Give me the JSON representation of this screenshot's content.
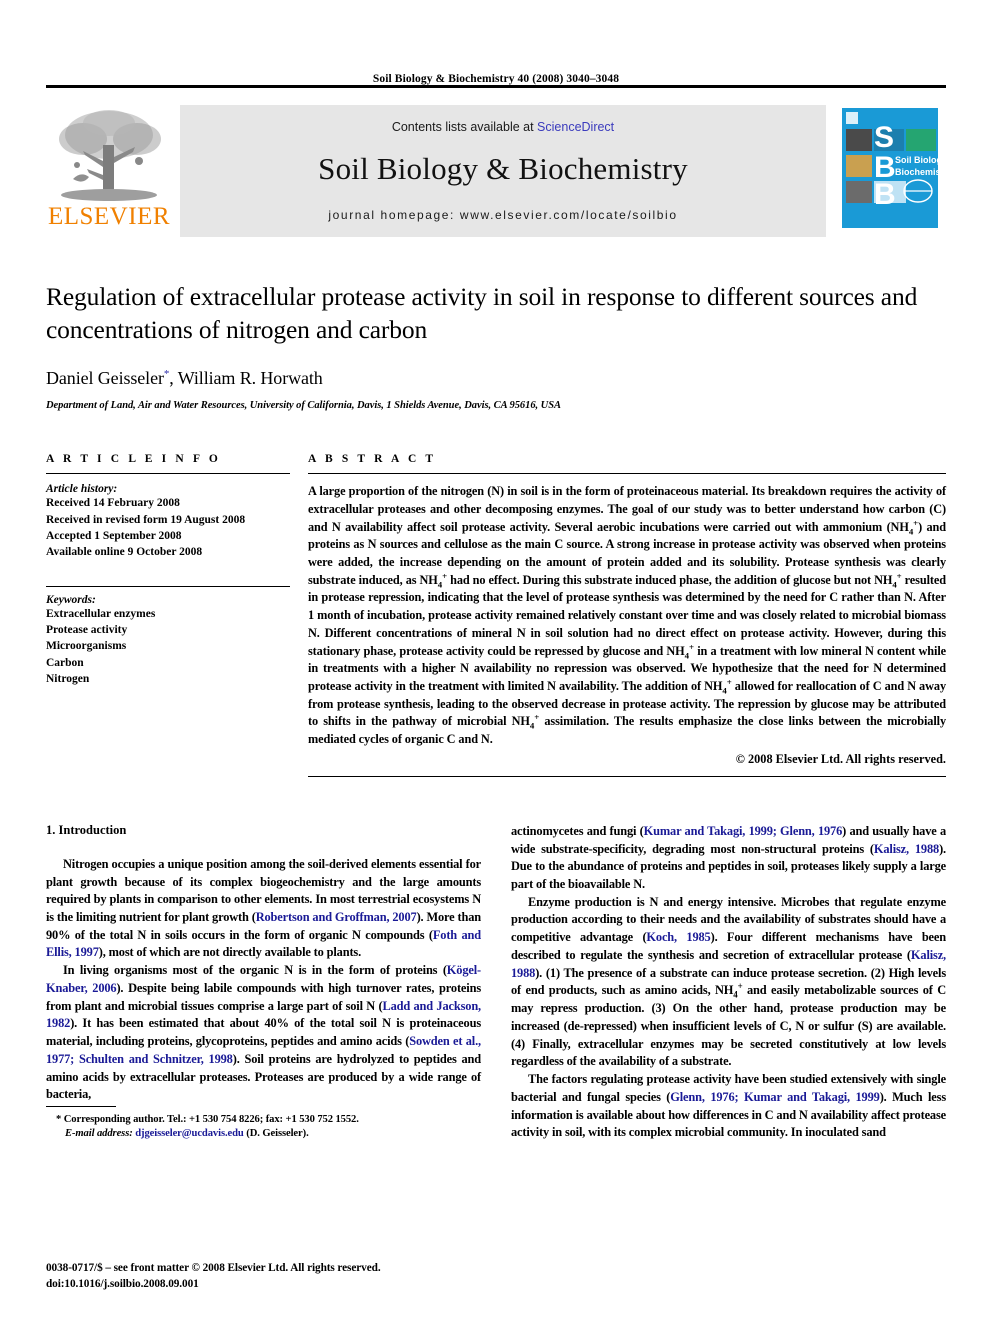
{
  "running_head": "Soil Biology & Biochemistry 40 (2008) 3040–3048",
  "masthead": {
    "publisher_name": "ELSEVIER",
    "contents_prefix": "Contents lists available at ",
    "contents_link": "ScienceDirect",
    "journal_title": "Soil Biology & Biochemistry",
    "journal_homepage": "journal homepage: www.elsevier.com/locate/soilbio",
    "cover_letters": [
      "S",
      "B",
      "B"
    ],
    "cover_title_line1": "Soil Biology &",
    "cover_title_line2": "Biochemistry",
    "link_color": "#3b3bbd",
    "accent_color": "#f08000",
    "cover_bg_color": "#1a9ad6"
  },
  "article": {
    "title": "Regulation of extracellular protease activity in soil in response to different sources and concentrations of nitrogen and carbon",
    "authors": "Daniel Geisseler, William R. Horwath",
    "author_marker": "*",
    "affiliation": "Department of Land, Air and Water Resources, University of California, Davis, 1 Shields Avenue, Davis, CA 95616, USA"
  },
  "article_info": {
    "label": "A R T I C L E   I N F O",
    "history_label": "Article history:",
    "history": [
      "Received 14 February 2008",
      "Received in revised form 19 August 2008",
      "Accepted 1 September 2008",
      "Available online 9 October 2008"
    ],
    "keywords_label": "Keywords:",
    "keywords": [
      "Extracellular enzymes",
      "Protease activity",
      "Microorganisms",
      "Carbon",
      "Nitrogen"
    ]
  },
  "abstract": {
    "label": "A B S T R A C T",
    "text": "A large proportion of the nitrogen (N) in soil is in the form of proteinaceous material. Its breakdown requires the activity of extracellular proteases and other decomposing enzymes. The goal of our study was to better understand how carbon (C) and N availability affect soil protease activity. Several aerobic incubations were carried out with ammonium (NH4+) and proteins as N sources and cellulose as the main C source. A strong increase in protease activity was observed when proteins were added, the increase depending on the amount of protein added and its solubility. Protease synthesis was clearly substrate induced, as NH4+ had no effect. During this substrate induced phase, the addition of glucose but not NH4+ resulted in protease repression, indicating that the level of protease synthesis was determined by the need for C rather than N. After 1 month of incubation, protease activity remained relatively constant over time and was closely related to microbial biomass N. Different concentrations of mineral N in soil solution had no direct effect on protease activity. However, during this stationary phase, protease activity could be repressed by glucose and NH4+ in a treatment with low mineral N content while in treatments with a higher N availability no repression was observed. We hypothesize that the need for N determined protease activity in the treatment with limited N availability. The addition of NH4+ allowed for reallocation of C and N away from protease synthesis, leading to the observed decrease in protease activity. The repression by glucose may be attributed to shifts in the pathway of microbial NH4+ assimilation. The results emphasize the close links between the microbially mediated cycles of organic C and N.",
    "copyright": "© 2008 Elsevier Ltd. All rights reserved."
  },
  "section": {
    "number_title": "1.  Introduction"
  },
  "body": {
    "left_paragraphs": [
      "Nitrogen occupies a unique position among the soil-derived elements essential for plant growth because of its complex biogeochemistry and the large amounts required by plants in comparison to other elements. In most terrestrial ecosystems N is the limiting nutrient for plant growth (Robertson and Groffman, 2007). More than 90% of the total N in soils occurs in the form of organic N compounds (Foth and Ellis, 1997), most of which are not directly available to plants.",
      "In living organisms most of the organic N is in the form of proteins (Kögel-Knaber, 2006). Despite being labile compounds with high turnover rates, proteins from plant and microbial tissues comprise a large part of soil N (Ladd and Jackson, 1982). It has been estimated that about 40% of the total soil N is proteinaceous material, including proteins, glycoproteins, peptides and amino acids (Sowden et al., 1977; Schulten and Schnitzer, 1998). Soil proteins are hydrolyzed to peptides and amino acids by extracellular proteases. Proteases are produced by a wide range of bacteria,"
    ],
    "right_paragraphs": [
      "actinomycetes and fungi (Kumar and Takagi, 1999; Glenn, 1976) and usually have a wide substrate-specificity, degrading most non-structural proteins (Kalisz, 1988). Due to the abundance of proteins and peptides in soil, proteases likely supply a large part of the bioavailable N.",
      "Enzyme production is N and energy intensive. Microbes that regulate enzyme production according to their needs and the availability of substrates should have a competitive advantage (Koch, 1985). Four different mechanisms have been described to regulate the synthesis and secretion of extracellular protease (Kalisz, 1988). (1) The presence of a substrate can induce protease secretion. (2) High levels of end products, such as amino acids, NH4+ and easily metabolizable sources of C may repress production. (3) On the other hand, protease production may be increased (de-repressed) when insufficient levels of C, N or sulfur (S) are available. (4) Finally, extracellular enzymes may be secreted constitutively at low levels regardless of the availability of a substrate.",
      "The factors regulating protease activity have been studied extensively with single bacterial and fungal species (Glenn, 1976; Kumar and Takagi, 1999). Much less information is available about how differences in C and N availability affect protease activity in soil, with its complex microbial community. In inoculated sand"
    ]
  },
  "footnote": {
    "corresponding": "* Corresponding author. Tel.: +1 530 754 8226; fax: +1 530 752 1552.",
    "email_label": "E-mail address:",
    "email": "djgeisseler@ucdavis.edu",
    "email_attrib": "(D. Geisseler)."
  },
  "page_footer": {
    "line1": "0038-0717/$ – see front matter © 2008 Elsevier Ltd. All rights reserved.",
    "line2": "doi:10.1016/j.soilbio.2008.09.001"
  }
}
